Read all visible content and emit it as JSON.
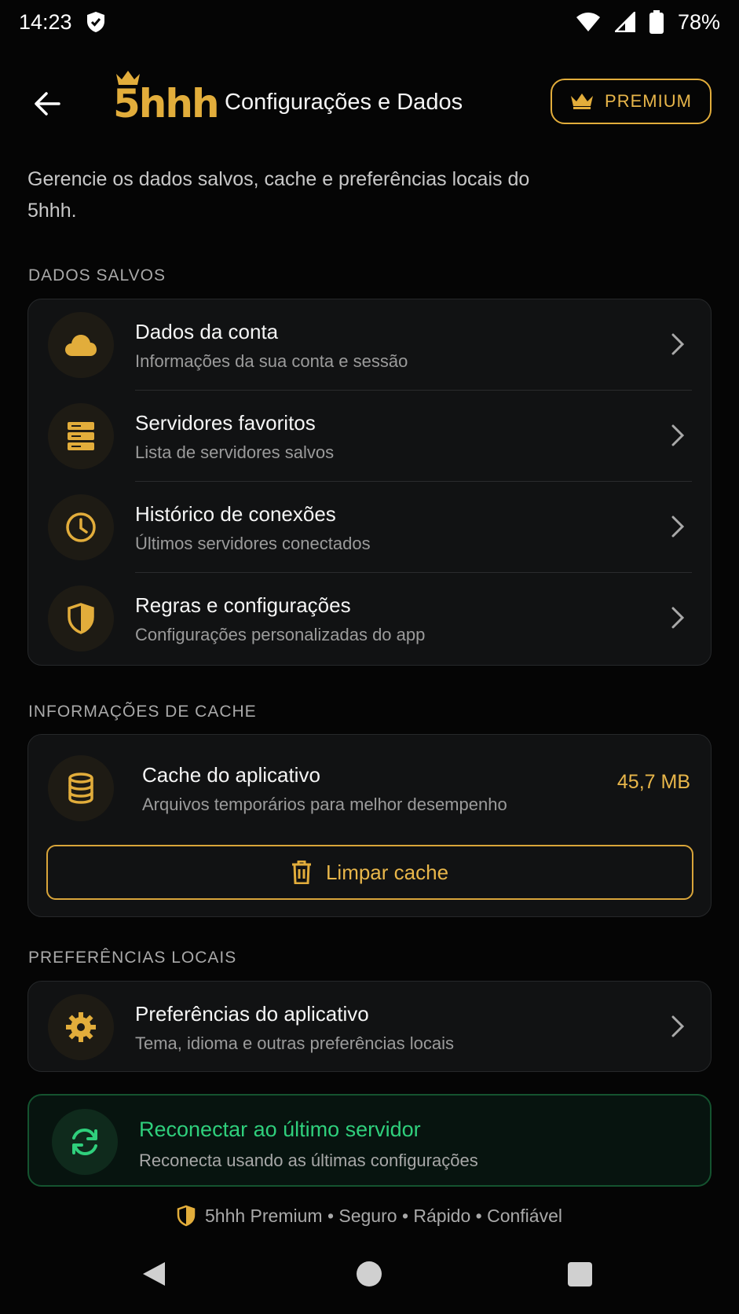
{
  "status_bar": {
    "time": "14:23",
    "battery_pct": "78%",
    "icons": [
      "shield-check-icon",
      "wifi-icon",
      "signal-icon",
      "battery-icon"
    ]
  },
  "header": {
    "logo_text": "5hhh",
    "title": "Configurações e Dados",
    "premium_label": "PREMIUM"
  },
  "description": "Gerencie os dados salvos, cache e preferências locais do 5hhh.",
  "saved_data": {
    "section_label": "DADOS SALVOS",
    "items": [
      {
        "title": "Dados da conta",
        "subtitle": "Informações da sua conta e sessão",
        "icon": "cloud-icon"
      },
      {
        "title": "Servidores favoritos",
        "subtitle": "Lista de servidores salvos",
        "icon": "server-icon"
      },
      {
        "title": "Histórico de conexões",
        "subtitle": "Últimos servidores conectados",
        "icon": "clock-icon"
      },
      {
        "title": "Regras e configurações",
        "subtitle": "Configurações personalizadas do app",
        "icon": "shield-icon"
      }
    ]
  },
  "cache": {
    "section_label": "INFORMAÇÕES DE CACHE",
    "title": "Cache do aplicativo",
    "subtitle": "Arquivos temporários para melhor desempenho",
    "size": "45,7 MB",
    "clear_label": "Limpar cache"
  },
  "local_prefs": {
    "section_label": "PREFERÊNCIAS LOCAIS",
    "title": "Preferências do aplicativo",
    "subtitle": "Tema, idioma e outras preferências locais"
  },
  "reconnect": {
    "title": "Reconectar ao último servidor",
    "subtitle": "Reconecta usando as últimas configurações"
  },
  "footer": {
    "text": "5hhh Premium • Seguro • Rápido • Confiável"
  },
  "colors": {
    "accent": "#e2ad3b",
    "success": "#2fcf7c",
    "background": "#050505",
    "card": "#111213"
  }
}
